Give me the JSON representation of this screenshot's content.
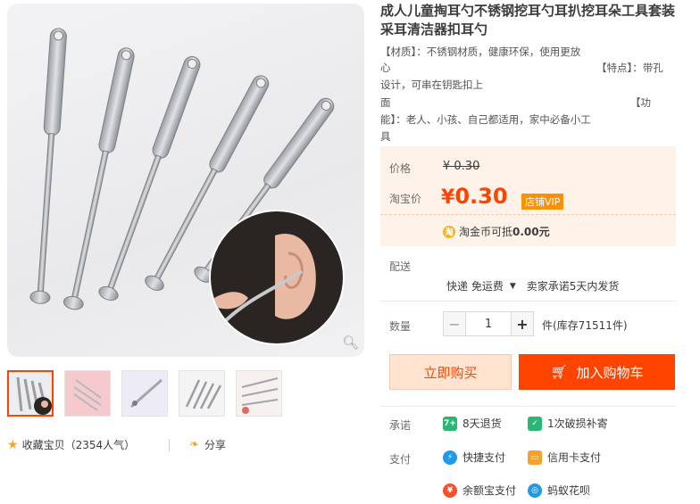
{
  "product": {
    "title": "成人儿童掏耳勺不锈钢挖耳勺耳扒挖耳朵工具套装采耳清洁器扣耳勺",
    "desc_lines": [
      "【材质】：不锈钢材质，健康环保，使用更放",
      "心",
      "【特点】：带孔",
      "设计，可串在钥匙扣上",
      "面",
      "【功",
      "能】：老人、小孩、自己都适用，家中必备小工",
      "具"
    ]
  },
  "price": {
    "label": "价格",
    "original": "¥ 0.30",
    "taobao_label": "淘宝价",
    "currency": "¥",
    "current": "0.30",
    "vip_badge": "店铺VIP",
    "coin_icon_text": "淘",
    "coin_text": "淘金币可抵",
    "coin_amount": "0.00元"
  },
  "shipping": {
    "label": "配送",
    "method": "快递 免运费",
    "promise": "卖家承诺5天内发货"
  },
  "quantity": {
    "label": "数量",
    "minus": "−",
    "value": "1",
    "plus": "+",
    "stock": "件(库存71511件)"
  },
  "actions": {
    "buy_now": "立即购买",
    "add_to_cart": "加入购物车"
  },
  "promise": {
    "label": "承诺",
    "items": [
      {
        "icon": "7-days-return-icon",
        "badge": "7+",
        "text": "8天退货",
        "color": "#2bb673"
      },
      {
        "icon": "shield-check-icon",
        "badge": "✓",
        "text": "1次破损补寄",
        "color": "#2bb673"
      }
    ]
  },
  "payment": {
    "label": "支付",
    "items": [
      {
        "icon": "quick-pay-icon",
        "badge": "⚡",
        "text": "快捷支付",
        "color": "#1e9be8"
      },
      {
        "icon": "credit-card-icon",
        "badge": "▭",
        "text": "信用卡支付",
        "color": "#f7a12d"
      },
      {
        "icon": "yuebao-icon",
        "badge": "¥",
        "text": "余额宝支付",
        "color": "#f4512c"
      },
      {
        "icon": "huabei-icon",
        "badge": "◎",
        "text": "蚂蚁花呗",
        "color": "#1e9be8"
      }
    ]
  },
  "gallery": {
    "zoom_icon": "magnifier-icon",
    "thumb_count": 5
  },
  "social": {
    "favorite_label": "收藏宝贝",
    "favorite_count": "（2354人气）",
    "share_label": "分享"
  },
  "colors": {
    "accent": "#ff4400",
    "price_bg": "#fff2e8",
    "vip": "#ff9000"
  }
}
